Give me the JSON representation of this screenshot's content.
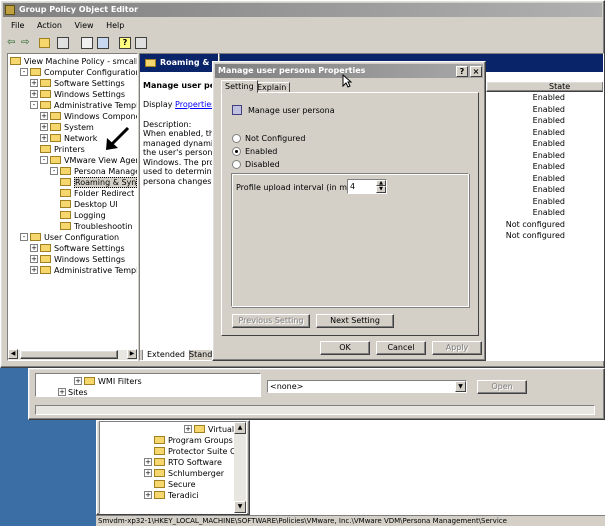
{
  "gpo": {
    "title": "Group Policy Object Editor",
    "menu": [
      "File",
      "Action",
      "View",
      "Help"
    ],
    "tree": [
      {
        "label": "View Machine Policy - smcallister [a",
        "indent": 0,
        "pm": ""
      },
      {
        "label": "Computer Configuration",
        "indent": 1,
        "pm": "-"
      },
      {
        "label": "Software Settings",
        "indent": 2,
        "pm": "+"
      },
      {
        "label": "Windows Settings",
        "indent": 2,
        "pm": "+"
      },
      {
        "label": "Administrative Templates",
        "indent": 2,
        "pm": "-"
      },
      {
        "label": "Windows Components",
        "indent": 3,
        "pm": "+"
      },
      {
        "label": "System",
        "indent": 3,
        "pm": "+"
      },
      {
        "label": "Network",
        "indent": 3,
        "pm": "+"
      },
      {
        "label": "Printers",
        "indent": 3,
        "pm": ""
      },
      {
        "label": "VMware View Agent Co",
        "indent": 3,
        "pm": "-"
      },
      {
        "label": "Persona Manageme",
        "indent": 4,
        "pm": "-"
      },
      {
        "label": "Roaming & Syn",
        "indent": 5,
        "pm": ""
      },
      {
        "label": "Folder Redirect",
        "indent": 5,
        "pm": ""
      },
      {
        "label": "Desktop UI",
        "indent": 5,
        "pm": ""
      },
      {
        "label": "Logging",
        "indent": 5,
        "pm": ""
      },
      {
        "label": "Troubleshootin",
        "indent": 5,
        "pm": ""
      },
      {
        "label": "User Configuration",
        "indent": 1,
        "pm": "-"
      },
      {
        "label": "Software Settings",
        "indent": 2,
        "pm": "+"
      },
      {
        "label": "Windows Settings",
        "indent": 2,
        "pm": "+"
      },
      {
        "label": "Administrative Templates",
        "indent": 2,
        "pm": "+"
      }
    ],
    "mid_header": "Roaming & Sy",
    "mid_title": "Manage user perso",
    "display_label": "Display",
    "display_link": "Properties",
    "description_label": "Description:",
    "description": [
      "When enabled, the us",
      "managed dynamically.",
      "the user's persona wi",
      "Windows.  The profile",
      "used to determine hov",
      "persona changes to th"
    ],
    "tabs": [
      "Extended",
      "Standa"
    ],
    "state_header": "State",
    "states": [
      "Enabled",
      "Enabled",
      "Enabled",
      "Enabled",
      "Enabled",
      "Enabled",
      "Enabled",
      "Enabled",
      "Enabled",
      "Enabled",
      "Enabled",
      "Not configured",
      "Not configured"
    ]
  },
  "dialog": {
    "title": "Manage user persona Properties",
    "tabs": [
      "Setting",
      "Explain"
    ],
    "policy_name": "Manage user persona",
    "options": [
      "Not Configured",
      "Enabled",
      "Disabled"
    ],
    "selected": 1,
    "interval_label": "Profile upload interval (in minutes):",
    "interval_value": "4",
    "prev_button": "Previous Setting",
    "next_button": "Next Setting",
    "ok": "OK",
    "cancel": "Cancel",
    "apply": "Apply"
  },
  "back": {
    "wmi": "WMI Filters",
    "sites": "Sites",
    "none_option": "<none>",
    "open_button": "Open",
    "tree": [
      "Virtual P",
      "Program Groups",
      "Protector Suite QL",
      "RTO Software",
      "Schlumberger",
      "Secure",
      "Teradici"
    ]
  },
  "status_path": "Smvdm-xp32-1\\HKEY_LOCAL_MACHINE\\SOFTWARE\\Policies\\VMware, Inc.\\VMware VDM\\Persona Management\\Service"
}
